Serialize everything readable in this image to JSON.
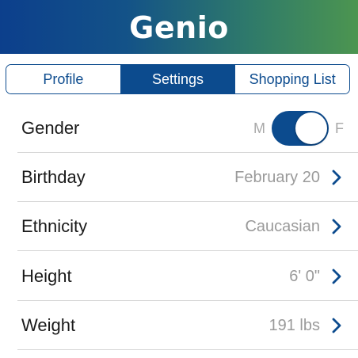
{
  "app": {
    "title": "Genio"
  },
  "colors": {
    "brand_blue": "#0c4b8e",
    "header_gradient_start": "#0c3f8c",
    "header_gradient_end": "#4c9550",
    "value_gray": "#9a9a9a"
  },
  "tabs": [
    {
      "label": "Profile",
      "active": false
    },
    {
      "label": "Settings",
      "active": true
    },
    {
      "label": "Shopping List",
      "active": false
    }
  ],
  "settings": {
    "gender": {
      "label": "Gender",
      "left_option": "M",
      "right_option": "F",
      "toggle_on": true
    },
    "rows": [
      {
        "label": "Birthday",
        "value": "February 20",
        "icon": "chevron-right-icon"
      },
      {
        "label": "Ethnicity",
        "value": "Caucasian",
        "icon": "chevron-right-icon"
      },
      {
        "label": "Height",
        "value": "6' 0\"",
        "icon": "chevron-right-icon"
      },
      {
        "label": "Weight",
        "value": "191 lbs",
        "icon": "chevron-right-icon"
      }
    ]
  }
}
